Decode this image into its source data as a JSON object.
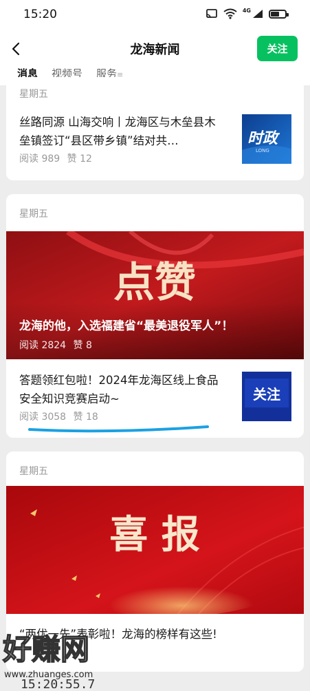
{
  "status_bar": {
    "time": "15:20",
    "network": "4G",
    "icons": [
      "cast-icon",
      "wifi-icon",
      "signal-icon",
      "battery-icon"
    ],
    "battery_level": 0.55
  },
  "header": {
    "title": "龙海新闻",
    "follow_label": "关注",
    "back_icon": "chevron-left-icon"
  },
  "tabs": [
    {
      "label": "消息",
      "active": true
    },
    {
      "label": "视频号",
      "active": false
    },
    {
      "label": "服务",
      "active": false
    }
  ],
  "cards": [
    {
      "day": "星期五",
      "items": [
        {
          "title": "丝路同源 山海交响丨龙海区与木垒县木垒镇签订“县区带乡镇”结对共…",
          "reads": "阅读 989",
          "likes": "赞 12",
          "thumb_text": "时政",
          "thumb_subtext": "LONG"
        }
      ]
    },
    {
      "day": "星期五",
      "banner": {
        "image_text": "点赞",
        "title": "龙海的他，入选福建省“最美退役军人”！",
        "reads": "阅读 2824",
        "likes": "赞 8"
      },
      "items": [
        {
          "title": "答题领红包啦！2024年龙海区线上食品安全知识竞赛启动~",
          "reads": "阅读 3058",
          "likes": "赞 18",
          "thumb_text": "关注"
        }
      ]
    },
    {
      "day": "星期五",
      "banner": {
        "image_text": "喜 报",
        "title": "“两优一先”表彰啦！龙海的榜样有这些!"
      }
    }
  ],
  "watermark": {
    "text": "好赚网",
    "url": "www.zhuanges.com",
    "clock": "15:20:55.7"
  },
  "colors": {
    "accent_green": "#07c160",
    "banner_red": "#b71c1c",
    "underline_blue": "#1ba1e2",
    "meta_gray": "#999999"
  }
}
